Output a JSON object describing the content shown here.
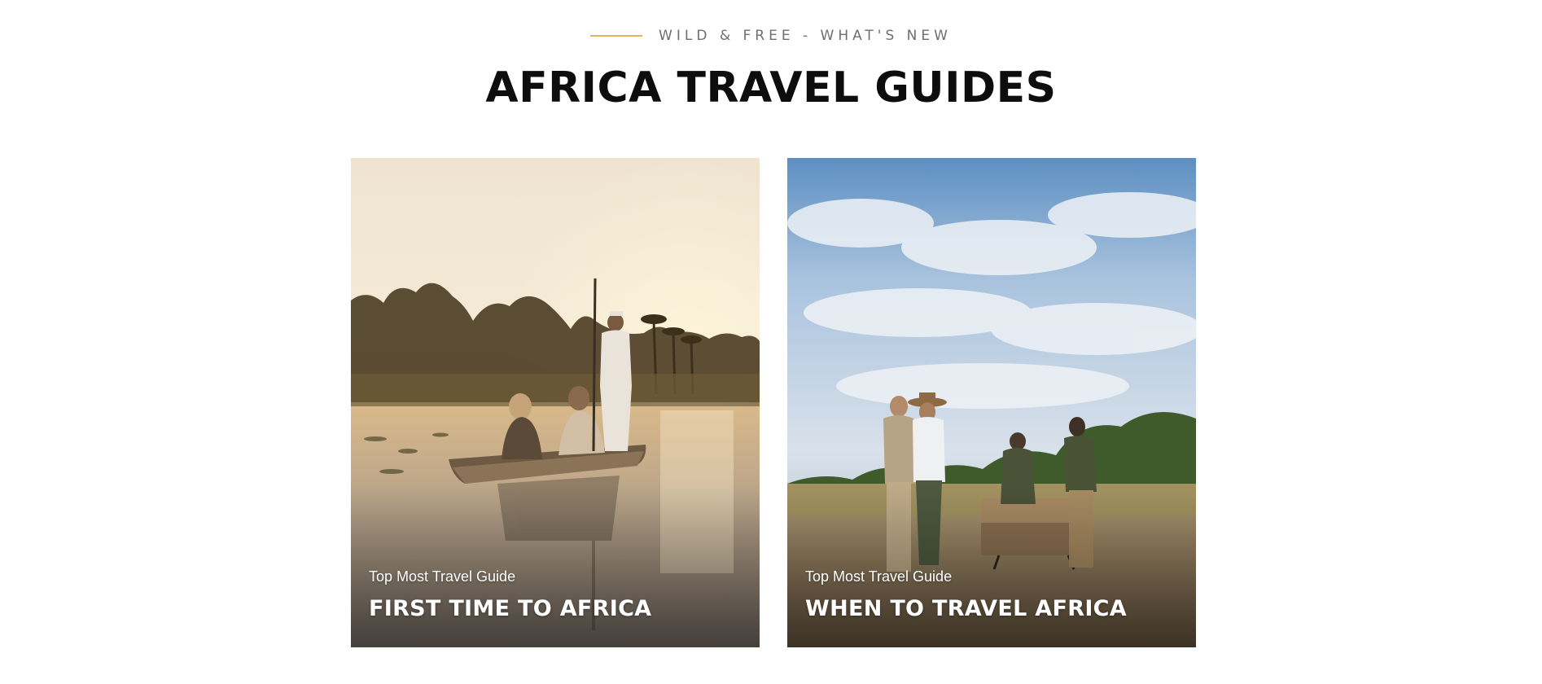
{
  "section": {
    "eyebrow": "WILD & FREE - WHAT'S NEW",
    "title": "AFRICA TRAVEL GUIDES"
  },
  "cards": [
    {
      "kicker": "Top Most Travel Guide",
      "title": "FIRST TIME TO AFRICA",
      "image": "mokoro-canoe-sunset-photo"
    },
    {
      "kicker": "Top Most Travel Guide",
      "title": "WHEN TO TRAVEL AFRICA",
      "image": "bush-sundowner-safari-photo"
    }
  ],
  "colors": {
    "accent_rule": "#e8b25c",
    "eyebrow_text": "#6f6f6f",
    "title_text": "#0d0d0d"
  }
}
